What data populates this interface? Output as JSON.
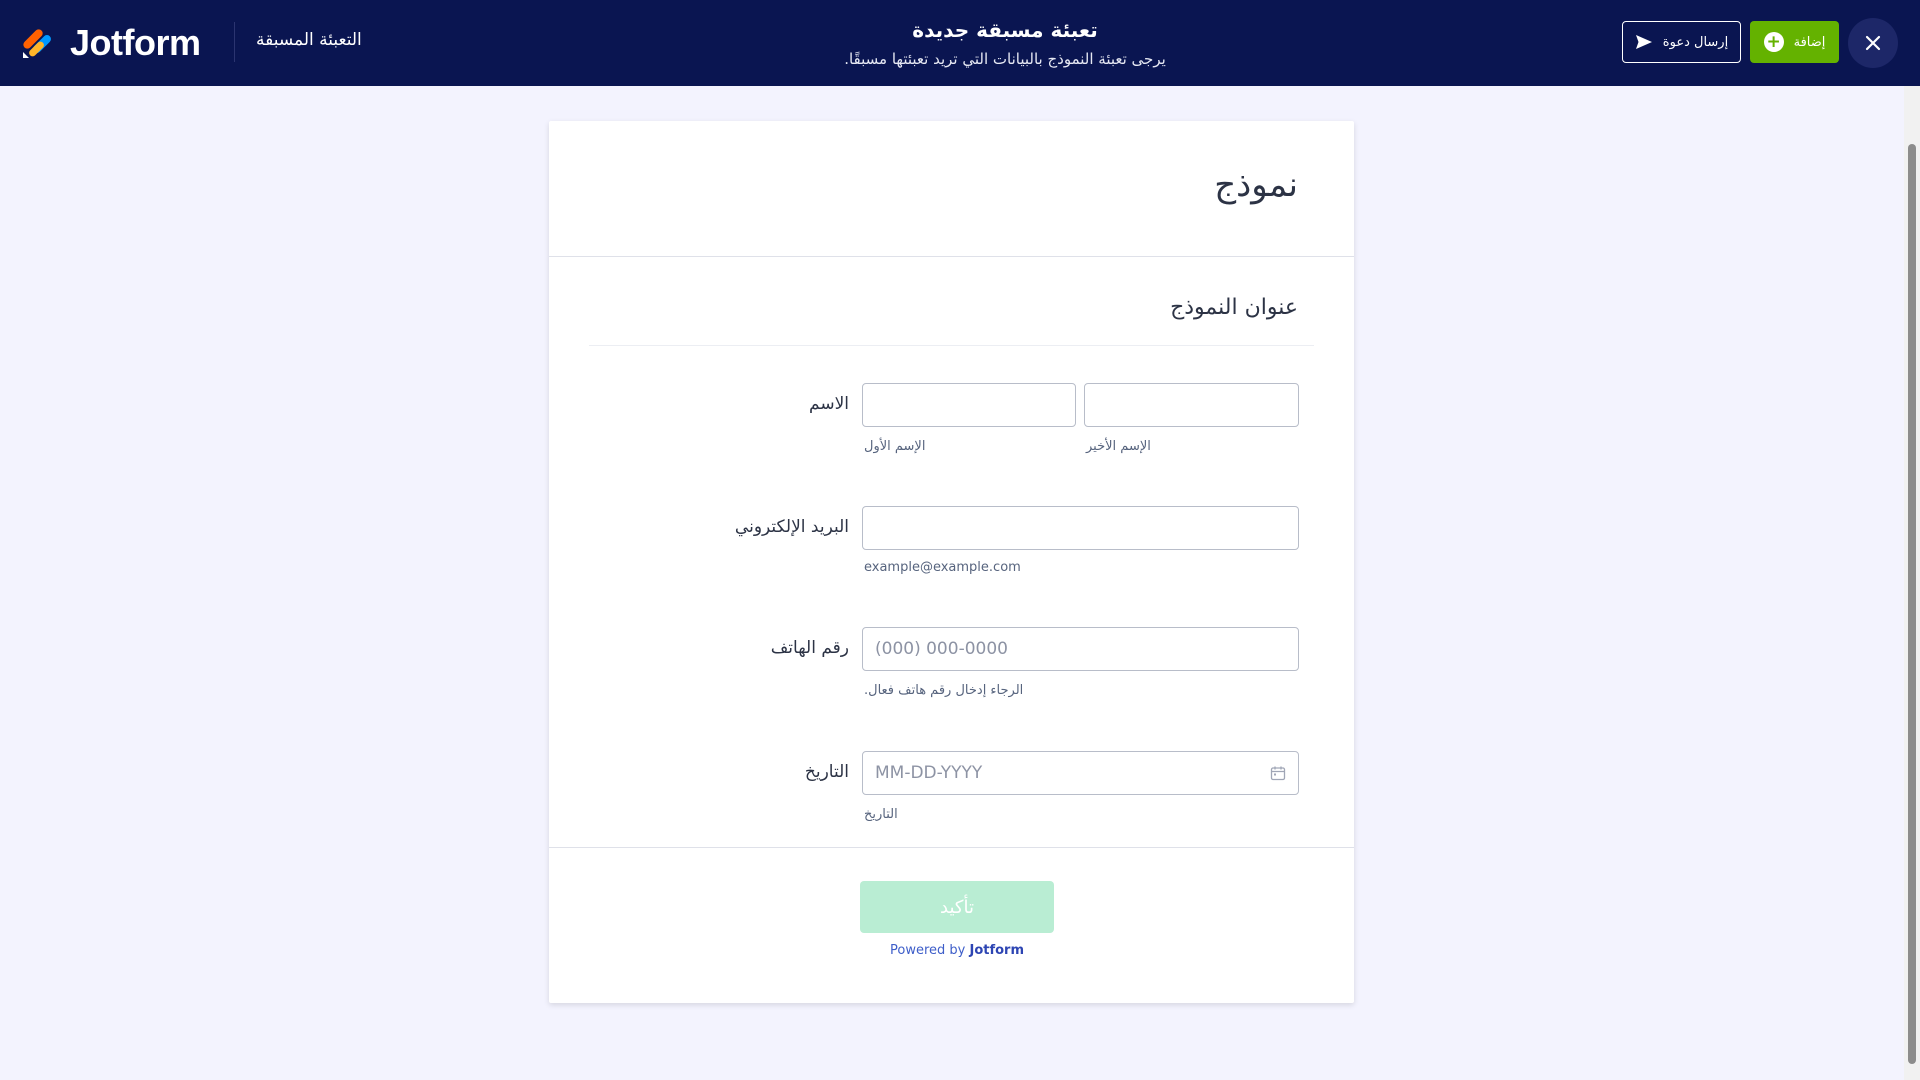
{
  "header": {
    "brand": "Jotform",
    "section_label": "التعبئة المسبقة",
    "title": "تعبئة مسبقة جديدة",
    "subtitle": "يرجى تعبئة النموذج بالبيانات التي تريد تعبئتها مسبقًا.",
    "invite_label": "إرسال دعوة",
    "add_label": "إضافة"
  },
  "form": {
    "title": "نموذج",
    "section_title": "عنوان النموذج",
    "name": {
      "label": "الاسم",
      "first_sublabel": "الإسم الأول",
      "last_sublabel": "الإسم الأخير"
    },
    "email": {
      "label": "البريد الإلكتروني",
      "sublabel": "example@example.com"
    },
    "phone": {
      "label": "رقم الهاتف",
      "placeholder": "(000) 000-0000",
      "sublabel": "الرجاء إدخال رقم هاتف فعال."
    },
    "date": {
      "label": "التاريخ",
      "placeholder": "MM-DD-YYYY",
      "sublabel": "التاريخ"
    },
    "submit_label": "تأكيد",
    "powered_prefix": "Powered by",
    "powered_brand": "Jotform"
  },
  "colors": {
    "header_bg": "#0a1551",
    "add_button": "#64b200",
    "submit_disabled": "#b9edd3",
    "page_bg": "#f3f3fe"
  },
  "icons": [
    "jotform-logo-icon",
    "send-icon",
    "plus-circle-icon",
    "close-icon",
    "calendar-icon"
  ]
}
